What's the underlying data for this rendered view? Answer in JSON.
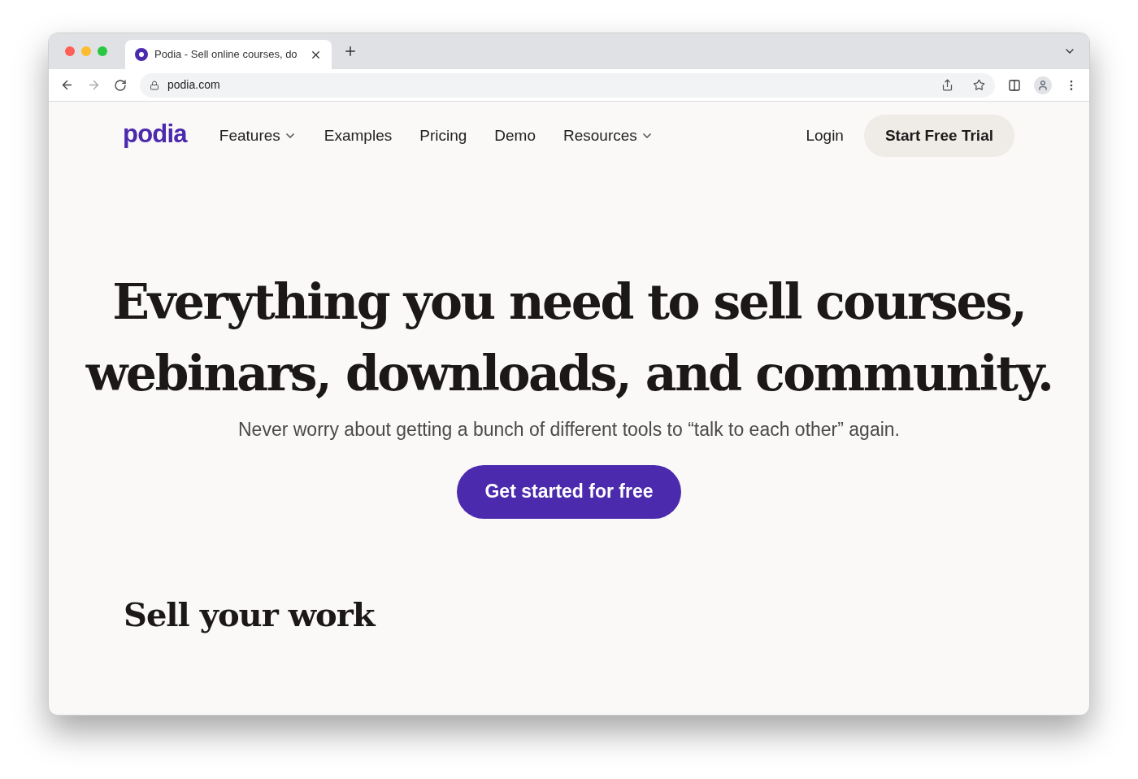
{
  "browser": {
    "tab": {
      "title": "Podia - Sell online courses, do",
      "selected": true
    },
    "address": "podia.com"
  },
  "nav": {
    "logo": "podia",
    "items": [
      {
        "label": "Features",
        "dropdown": true
      },
      {
        "label": "Examples",
        "dropdown": false
      },
      {
        "label": "Pricing",
        "dropdown": false
      },
      {
        "label": "Demo",
        "dropdown": false
      },
      {
        "label": "Resources",
        "dropdown": true
      }
    ],
    "login": "Login",
    "cta": "Start Free Trial"
  },
  "hero": {
    "title": "Everything you need to sell courses, webinars, downloads, and community.",
    "subtitle": "Never worry about getting a bunch of different tools to “talk to each other” again.",
    "button": "Get started for free"
  },
  "section": {
    "title": "Sell your work"
  }
}
